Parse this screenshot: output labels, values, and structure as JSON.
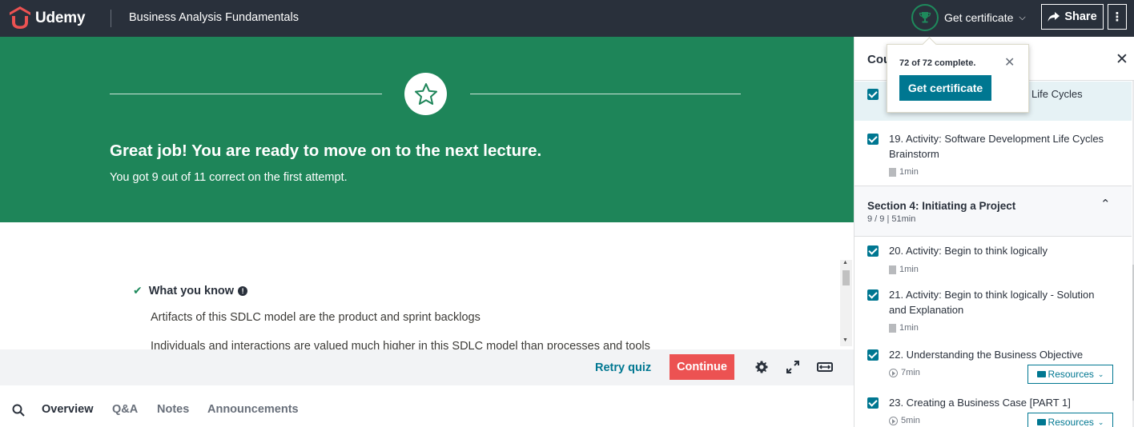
{
  "header": {
    "brand": "Udemy",
    "course_title": "Business Analysis Fundamentals",
    "certificate_label": "Get certificate",
    "share_label": "Share",
    "more_label": "⋮"
  },
  "banner": {
    "title": "Great job! You are ready to move on to the next lecture.",
    "subtitle": "You got 9 out of 11 correct on the first attempt."
  },
  "results": {
    "heading": "What you know",
    "items": [
      "Artifacts of this SDLC model are the product and sprint backlogs",
      "Individuals and interactions are valued much higher in this SDLC model than processes and tools"
    ]
  },
  "controls": {
    "retry_label": "Retry quiz",
    "continue_label": "Continue"
  },
  "tabs": {
    "items": [
      "Overview",
      "Q&A",
      "Notes",
      "Announcements"
    ],
    "active": "Overview"
  },
  "sidebar": {
    "title": "Cou",
    "close": "✕",
    "lectures_top": [
      {
        "title": "Life Cycles",
        "checked": true
      },
      {
        "title": "19. Activity: Software Development Life Cycles Brainstorm",
        "meta": "1min",
        "meta_icon": "doc",
        "checked": true
      }
    ],
    "section": {
      "title": "Section 4: Initiating a Project",
      "meta": "9 / 9 | 51min"
    },
    "lectures": [
      {
        "title": "20. Activity: Begin to think logically",
        "meta": "1min",
        "meta_icon": "doc",
        "checked": true
      },
      {
        "title": "21. Activity: Begin to think logically - Solution and Explanation",
        "meta": "1min",
        "meta_icon": "doc",
        "checked": true
      },
      {
        "title": "22. Understanding the Business Objective",
        "meta": "7min",
        "meta_icon": "play",
        "resources": "Resources",
        "checked": true
      },
      {
        "title": "23. Creating a Business Case [PART 1]",
        "meta": "5min",
        "meta_icon": "play",
        "resources": "Resources",
        "checked": true
      }
    ]
  },
  "popover": {
    "status": "72 of 72 complete.",
    "button_label": "Get certificate",
    "close": "✕"
  },
  "colors": {
    "topbar": "#29303b",
    "banner": "#1e8559",
    "accent": "#007791",
    "continue": "#ec5252",
    "success": "#1e8a5c"
  }
}
